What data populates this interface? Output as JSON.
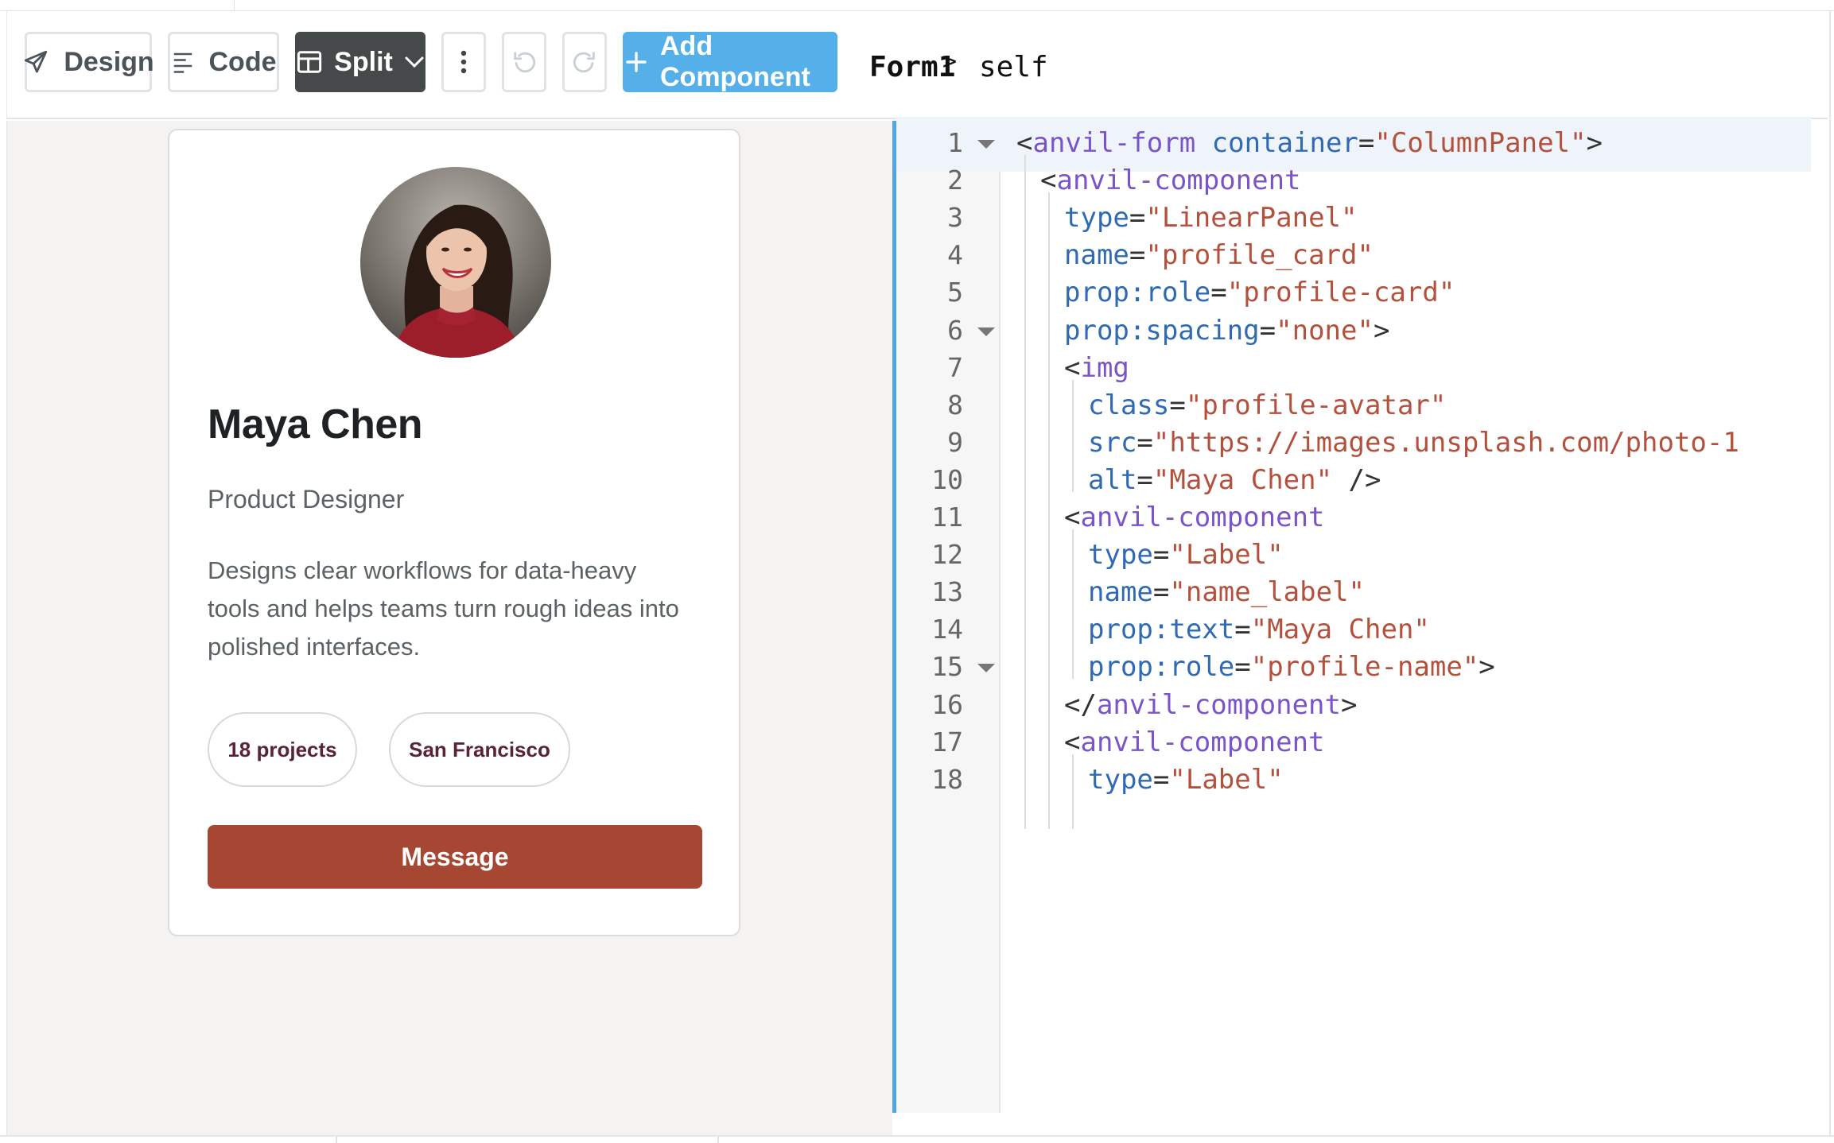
{
  "toolbar": {
    "design_label": "Design",
    "code_label": "Code",
    "split_label": "Split",
    "add_component_label": "Add Component"
  },
  "breadcrumb": {
    "form": "Form1",
    "separator": ">",
    "self": "self"
  },
  "profile": {
    "name": "Maya Chen",
    "role": "Product Designer",
    "bio": "Designs clear workflows for data-heavy tools and helps teams turn rough ideas into polished interfaces.",
    "chips": [
      "18 projects",
      "San Francisco"
    ],
    "message_label": "Message"
  },
  "colors": {
    "accent_blue": "#55b0ea",
    "split_dark": "#45494a",
    "message_button": "#a64734",
    "chip_text": "#5a2336",
    "code_tag": "#7a54c8",
    "code_attr": "#2f6ab3",
    "code_string": "#b4513c"
  },
  "icons": {
    "design": "paper-plane-icon",
    "code": "align-left-icon",
    "split": "split-panel-icon",
    "more": "vertical-dots-icon",
    "undo": "undo-icon",
    "redo": "redo-icon",
    "add": "plus-icon"
  },
  "editor": {
    "lines": [
      {
        "n": "1",
        "fold": true,
        "active": true,
        "indent": 0,
        "tokens": [
          {
            "t": "pun",
            "v": "<"
          },
          {
            "t": "tag",
            "v": "anvil-form"
          },
          {
            "t": "pun",
            "v": " "
          },
          {
            "t": "attr",
            "v": "container"
          },
          {
            "t": "pun",
            "v": "="
          },
          {
            "t": "str",
            "v": "\"ColumnPanel\""
          },
          {
            "t": "pun",
            "v": ">"
          }
        ]
      },
      {
        "n": "2",
        "fold": false,
        "indent": 1,
        "tokens": [
          {
            "t": "pun",
            "v": "<"
          },
          {
            "t": "tag",
            "v": "anvil-component"
          }
        ]
      },
      {
        "n": "3",
        "fold": false,
        "indent": 2,
        "tokens": [
          {
            "t": "attr",
            "v": "type"
          },
          {
            "t": "pun",
            "v": "="
          },
          {
            "t": "str",
            "v": "\"LinearPanel\""
          }
        ]
      },
      {
        "n": "4",
        "fold": false,
        "indent": 2,
        "tokens": [
          {
            "t": "attr",
            "v": "name"
          },
          {
            "t": "pun",
            "v": "="
          },
          {
            "t": "str",
            "v": "\"profile_card\""
          }
        ]
      },
      {
        "n": "5",
        "fold": false,
        "indent": 2,
        "tokens": [
          {
            "t": "attr",
            "v": "prop:role"
          },
          {
            "t": "pun",
            "v": "="
          },
          {
            "t": "str",
            "v": "\"profile-card\""
          }
        ]
      },
      {
        "n": "6",
        "fold": true,
        "indent": 2,
        "tokens": [
          {
            "t": "attr",
            "v": "prop:spacing"
          },
          {
            "t": "pun",
            "v": "="
          },
          {
            "t": "str",
            "v": "\"none\""
          },
          {
            "t": "pun",
            "v": ">"
          }
        ]
      },
      {
        "n": "7",
        "fold": false,
        "indent": 2,
        "tokens": [
          {
            "t": "pun",
            "v": "<"
          },
          {
            "t": "tag",
            "v": "img"
          }
        ]
      },
      {
        "n": "8",
        "fold": false,
        "indent": 3,
        "tokens": [
          {
            "t": "attr",
            "v": "class"
          },
          {
            "t": "pun",
            "v": "="
          },
          {
            "t": "str",
            "v": "\"profile-avatar\""
          }
        ]
      },
      {
        "n": "9",
        "fold": false,
        "indent": 3,
        "tokens": [
          {
            "t": "attr",
            "v": "src"
          },
          {
            "t": "pun",
            "v": "="
          },
          {
            "t": "str",
            "v": "\"https://images.unsplash.com/photo-1"
          }
        ]
      },
      {
        "n": "10",
        "fold": false,
        "indent": 3,
        "tokens": [
          {
            "t": "attr",
            "v": "alt"
          },
          {
            "t": "pun",
            "v": "="
          },
          {
            "t": "str",
            "v": "\"Maya Chen\""
          },
          {
            "t": "pun",
            "v": " />"
          }
        ]
      },
      {
        "n": "11",
        "fold": false,
        "indent": 2,
        "tokens": [
          {
            "t": "pun",
            "v": "<"
          },
          {
            "t": "tag",
            "v": "anvil-component"
          }
        ]
      },
      {
        "n": "12",
        "fold": false,
        "indent": 3,
        "tokens": [
          {
            "t": "attr",
            "v": "type"
          },
          {
            "t": "pun",
            "v": "="
          },
          {
            "t": "str",
            "v": "\"Label\""
          }
        ]
      },
      {
        "n": "13",
        "fold": false,
        "indent": 3,
        "tokens": [
          {
            "t": "attr",
            "v": "name"
          },
          {
            "t": "pun",
            "v": "="
          },
          {
            "t": "str",
            "v": "\"name_label\""
          }
        ]
      },
      {
        "n": "14",
        "fold": false,
        "indent": 3,
        "tokens": [
          {
            "t": "attr",
            "v": "prop:text"
          },
          {
            "t": "pun",
            "v": "="
          },
          {
            "t": "str",
            "v": "\"Maya Chen\""
          }
        ]
      },
      {
        "n": "15",
        "fold": true,
        "indent": 3,
        "tokens": [
          {
            "t": "attr",
            "v": "prop:role"
          },
          {
            "t": "pun",
            "v": "="
          },
          {
            "t": "str",
            "v": "\"profile-name\""
          },
          {
            "t": "pun",
            "v": ">"
          }
        ]
      },
      {
        "n": "16",
        "fold": false,
        "indent": 2,
        "tokens": [
          {
            "t": "pun",
            "v": "</"
          },
          {
            "t": "tag",
            "v": "anvil-component"
          },
          {
            "t": "pun",
            "v": ">"
          }
        ]
      },
      {
        "n": "17",
        "fold": false,
        "indent": 2,
        "tokens": [
          {
            "t": "pun",
            "v": "<"
          },
          {
            "t": "tag",
            "v": "anvil-component"
          }
        ]
      },
      {
        "n": "18",
        "fold": false,
        "indent": 3,
        "tokens": [
          {
            "t": "attr",
            "v": "type"
          },
          {
            "t": "pun",
            "v": "="
          },
          {
            "t": "str",
            "v": "\"Label\""
          }
        ]
      }
    ]
  }
}
